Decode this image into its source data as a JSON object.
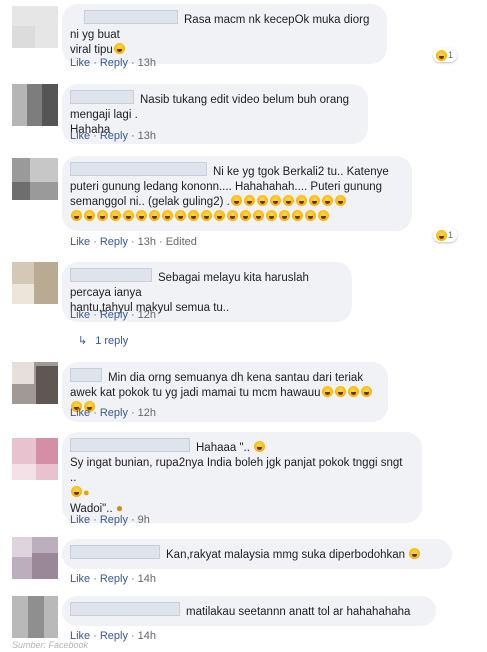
{
  "comments": [
    {
      "text_lines": [
        "Rasa macm nk kecepOk muka diorg ni yg buat",
        "viral tipu"
      ],
      "actions": {
        "like": "Like",
        "reply": "Reply",
        "time": "13h"
      },
      "reaction_count": "1"
    },
    {
      "text_lines": [
        "Nasib tukang edit video belum buh orang mengaji lagi .",
        "Hahaha"
      ],
      "actions": {
        "like": "Like",
        "reply": "Reply",
        "time": "13h"
      }
    },
    {
      "text_lines": [
        "Ni ke yg tgok Berkali2 tu.. Katenye",
        "puteri gunung ledang kononn.... Hahahahah.... Puteri gunung",
        "semanggol ni.. (gelak guling2) ."
      ],
      "actions": {
        "like": "Like",
        "reply": "Reply",
        "time": "13h",
        "edited": "Edited"
      },
      "reaction_count": "1"
    },
    {
      "text_lines": [
        "Sebagai melayu kita haruslah percaya ianya",
        "hantu,tahyul makyul semua tu.."
      ],
      "actions": {
        "like": "Like",
        "reply": "Reply",
        "time": "12h"
      },
      "replies_label": "1 reply"
    },
    {
      "text_lines": [
        "Min dia orng semuanya dh kena santau dari teriak",
        "awek kat pokok tu yg jadi mamai tu mcm hawauu"
      ],
      "actions": {
        "like": "Like",
        "reply": "Reply",
        "time": "12h"
      }
    },
    {
      "text_lines": [
        "Hahaaa \".. ",
        "Sy ingat bunian, rupa2nya India boleh jgk panjat pokok tnggi sngt ..",
        "",
        "Wadoi\".. "
      ],
      "actions": {
        "like": "Like",
        "reply": "Reply",
        "time": "9h"
      }
    },
    {
      "text_lines": [
        "Kan,rakyat malaysia mmg suka diperbodohkan"
      ],
      "actions": {
        "like": "Like",
        "reply": "Reply",
        "time": "14h"
      }
    },
    {
      "text_lines": [
        "matilakau seetannn anatt tol ar hahahahaha"
      ],
      "actions": {
        "like": "Like",
        "reply": "Reply",
        "time": "14h"
      }
    }
  ],
  "caption": "Sumber: Facebook",
  "colors": {
    "link": "#385898",
    "bubble": "#f0f2f5",
    "meta": "#65676b"
  },
  "icons": [
    "laughing-emoji-icon",
    "reply-arrow-icon"
  ]
}
